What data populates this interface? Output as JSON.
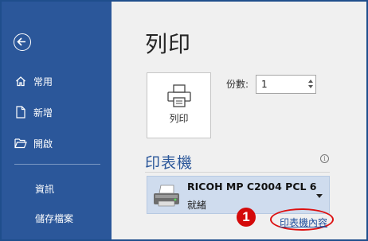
{
  "sidebar": {
    "back_icon": "back-arrow-icon",
    "items": [
      {
        "label": "常用",
        "icon": "home-icon"
      },
      {
        "label": "新增",
        "icon": "new-document-icon"
      },
      {
        "label": "開啟",
        "icon": "open-folder-icon"
      },
      {
        "label": "資訊"
      },
      {
        "label": "儲存檔案"
      }
    ]
  },
  "main": {
    "title": "列印",
    "print_button": {
      "label": "列印",
      "icon": "printer-icon"
    },
    "copies": {
      "label": "份數:",
      "value": "1"
    },
    "printer_section": {
      "heading": "印表機",
      "info_icon": "i",
      "selected_printer": {
        "name": "RICOH MP C2004 PCL 6",
        "status": "就緒"
      },
      "properties_link": "印表機內容"
    },
    "annotation": {
      "number": "1",
      "color": "#d40a0a"
    }
  },
  "colors": {
    "sidebar_bg": "#2b579a",
    "accent": "#2b579a",
    "link": "#1f4e9c"
  }
}
